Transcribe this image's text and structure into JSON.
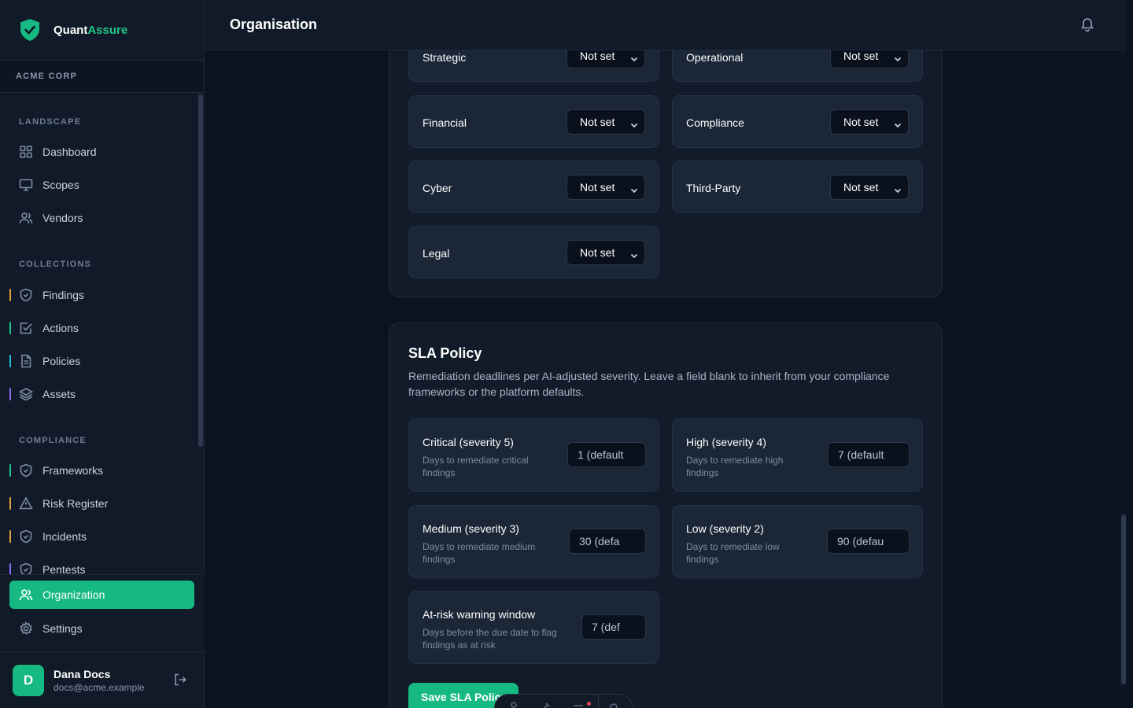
{
  "brand": {
    "name_primary": "Quant",
    "name_accent": "Assure"
  },
  "org": {
    "label": "ACME CORP"
  },
  "sidebar": {
    "sections": [
      {
        "title": "LANDSCAPE"
      },
      {
        "title": "COLLECTIONS"
      },
      {
        "title": "COMPLIANCE"
      }
    ],
    "items": [
      {
        "label": "Dashboard",
        "icon": "grid-icon"
      },
      {
        "label": "Scopes",
        "icon": "monitor-icon"
      },
      {
        "label": "Vendors",
        "icon": "users-icon"
      },
      {
        "label": "Findings",
        "icon": "shield-icon",
        "accent": "#e0a23b"
      },
      {
        "label": "Actions",
        "icon": "checkbox-icon",
        "accent": "#22c58b"
      },
      {
        "label": "Policies",
        "icon": "document-icon",
        "accent": "#2eb5d6"
      },
      {
        "label": "Assets",
        "icon": "layers-icon",
        "accent": "#8b6cf0"
      },
      {
        "label": "Frameworks",
        "icon": "shield-icon",
        "accent": "#22c58b"
      },
      {
        "label": "Risk Register",
        "icon": "warning-icon",
        "accent": "#e0a23b"
      },
      {
        "label": "Incidents",
        "icon": "shield-icon",
        "accent": "#e0a23b"
      },
      {
        "label": "Pentests",
        "icon": "shield-icon",
        "accent": "#8b6cf0"
      }
    ],
    "bottom": [
      {
        "label": "Organization",
        "icon": "users-icon",
        "active": true
      },
      {
        "label": "Settings",
        "icon": "gear-icon"
      }
    ]
  },
  "user": {
    "initial": "D",
    "name": "Dana Docs",
    "email": "docs@acme.example"
  },
  "header": {
    "title": "Organisation"
  },
  "risk_appetite": {
    "categories": [
      {
        "label": "Strategic",
        "value": "Not set"
      },
      {
        "label": "Operational",
        "value": "Not set"
      },
      {
        "label": "Financial",
        "value": "Not set"
      },
      {
        "label": "Compliance",
        "value": "Not set"
      },
      {
        "label": "Cyber",
        "value": "Not set"
      },
      {
        "label": "Third-Party",
        "value": "Not set"
      },
      {
        "label": "Legal",
        "value": "Not set"
      }
    ]
  },
  "sla": {
    "title": "SLA Policy",
    "description": "Remediation deadlines per AI-adjusted severity. Leave a field blank to inherit from your compliance frameworks or the platform defaults.",
    "fields": [
      {
        "title": "Critical (severity 5)",
        "sub": "Days to remediate critical findings",
        "placeholder": "1 (default"
      },
      {
        "title": "High (severity 4)",
        "sub": "Days to remediate high findings",
        "placeholder": "7 (default"
      },
      {
        "title": "Medium (severity 3)",
        "sub": "Days to remediate medium findings",
        "placeholder": "30 (defa"
      },
      {
        "title": "Low (severity 2)",
        "sub": "Days to remediate low findings",
        "placeholder": "90 (defau"
      },
      {
        "title": "At-risk warning window",
        "sub": "Days before the due date to flag findings as at risk",
        "placeholder": "7 (def"
      }
    ],
    "save_label": "Save SLA Policy"
  },
  "colors": {
    "accent": "#16b981",
    "brand_accent": "#22c58b"
  }
}
